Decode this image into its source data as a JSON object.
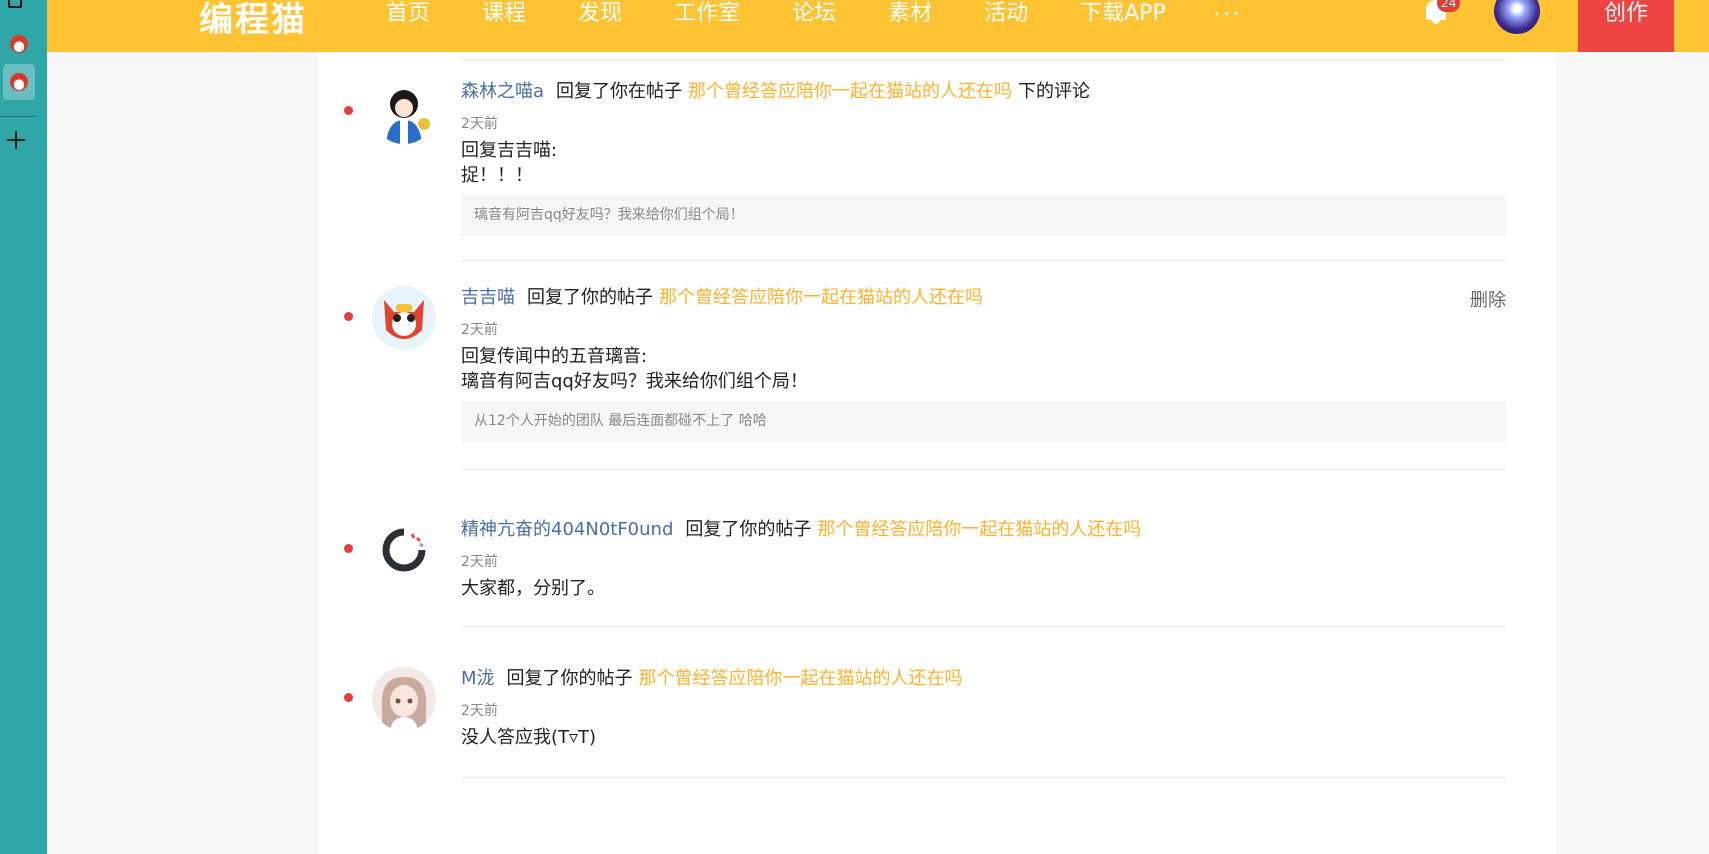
{
  "header": {
    "logo": "编程猫",
    "nav": [
      "首页",
      "课程",
      "发现",
      "工作室",
      "论坛",
      "素材",
      "活动",
      "下载APP"
    ],
    "more": "···",
    "notification_count": "24",
    "create_label": "创作"
  },
  "notifications": [
    {
      "username": "森林之喵a",
      "action": "回复了你在帖子",
      "post_title": "那个曾经答应陪你一起在猫站的人还在吗",
      "suffix": "下的评论",
      "time": "2天前",
      "content": "回复吉吉喵:\n捉！！！",
      "quote": "璃音有阿吉qq好友吗？我来给你们组个局！",
      "delete": ""
    },
    {
      "username": "吉吉喵",
      "action": "回复了你的帖子",
      "post_title": "那个曾经答应陪你一起在猫站的人还在吗",
      "suffix": "",
      "time": "2天前",
      "content": "回复传闻中的五音璃音:\n璃音有阿吉qq好友吗？我来给你们组个局！",
      "quote": "从12个人开始的团队 最后连面都碰不上了 哈哈",
      "delete": "删除"
    },
    {
      "username": "精神亢奋的404N0tF0und",
      "action": "回复了你的帖子",
      "post_title": "那个曾经答应陪你一起在猫站的人还在吗",
      "suffix": "",
      "time": "2天前",
      "content": "大家都，分别了。",
      "quote": "",
      "delete": ""
    },
    {
      "username": "M泷",
      "action": "回复了你的帖子",
      "post_title": "那个曾经答应陪你一起在猫站的人还在吗",
      "suffix": "",
      "time": "2天前",
      "content": "没人答应我(T▿T)",
      "quote": "",
      "delete": ""
    }
  ],
  "colors": {
    "header_bg": "#ffc334",
    "sidebar_bg": "#2fa6a8",
    "create_bg": "#ee4444",
    "username": "#4a6fa5",
    "post_link": "#ffb22c",
    "unread_dot": "#e43d3d"
  }
}
